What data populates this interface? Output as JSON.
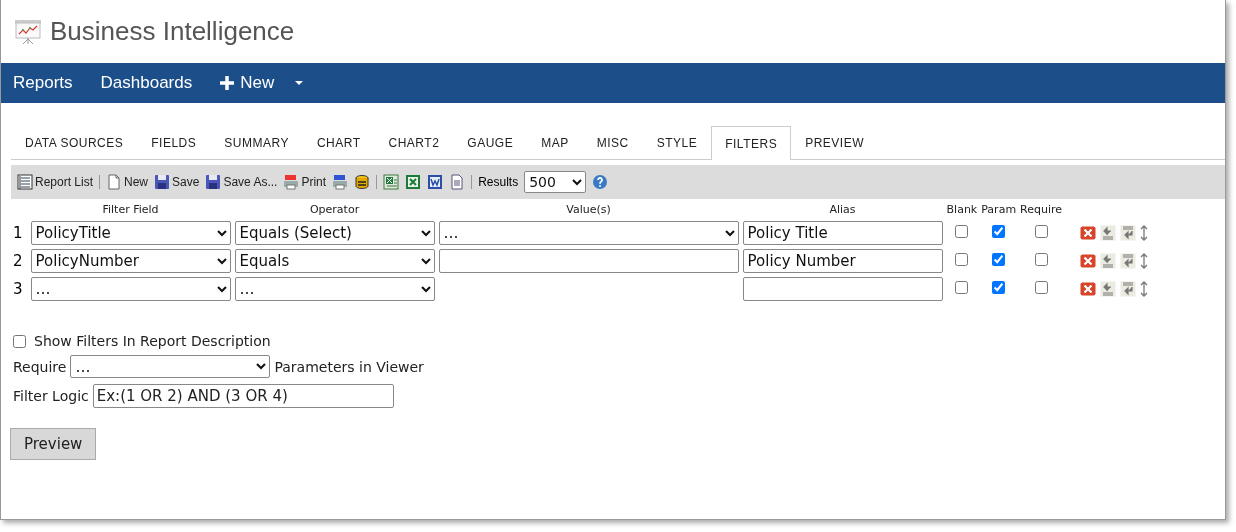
{
  "header": {
    "title": "Business Intelligence"
  },
  "nav": [
    {
      "label": "Reports",
      "kind": "link"
    },
    {
      "label": "Dashboards",
      "kind": "link"
    },
    {
      "label": "New",
      "kind": "new"
    }
  ],
  "tabs": [
    {
      "label": "DATA SOURCES",
      "selected": false
    },
    {
      "label": "FIELDS",
      "selected": false
    },
    {
      "label": "SUMMARY",
      "selected": false
    },
    {
      "label": "CHART",
      "selected": false
    },
    {
      "label": "CHART2",
      "selected": false
    },
    {
      "label": "GAUGE",
      "selected": false
    },
    {
      "label": "MAP",
      "selected": false
    },
    {
      "label": "MISC",
      "selected": false
    },
    {
      "label": "STYLE",
      "selected": false
    },
    {
      "label": "FILTERS",
      "selected": true
    },
    {
      "label": "PREVIEW",
      "selected": false
    }
  ],
  "toolbar": [
    {
      "kind": "button",
      "label": "Report List"
    },
    {
      "kind": "separator"
    },
    {
      "kind": "button",
      "label": "New"
    },
    {
      "kind": "button",
      "label": "Save"
    },
    {
      "kind": "button",
      "label": "Save As..."
    },
    {
      "kind": "button",
      "label": "Print"
    },
    {
      "kind": "icon"
    },
    {
      "kind": "icon"
    },
    {
      "kind": "separator"
    },
    {
      "kind": "icon"
    },
    {
      "kind": "icon"
    },
    {
      "kind": "icon"
    },
    {
      "kind": "icon"
    },
    {
      "kind": "separator"
    },
    {
      "kind": "results",
      "label": "Results",
      "value": "500"
    },
    {
      "kind": "icon"
    }
  ],
  "filters": {
    "columns": [
      "Filter Field",
      "Operator",
      "Value(s)",
      "Alias",
      "Blank",
      "Param",
      "Require"
    ],
    "rows": [
      {
        "number": "1",
        "field": "PolicyTitle",
        "operator": "Equals (Select)",
        "value": {
          "kind": "select",
          "text": "…"
        },
        "alias": "Policy Title",
        "blank": false,
        "param": true,
        "require": false
      },
      {
        "number": "2",
        "field": "PolicyNumber",
        "operator": "Equals",
        "value": {
          "kind": "input"
        },
        "alias": "Policy Number",
        "blank": false,
        "param": true,
        "require": false
      },
      {
        "number": "3",
        "field": "…",
        "operator": "…",
        "blank": false,
        "param": true,
        "require": false
      }
    ]
  },
  "options": {
    "show_filters": {
      "label": "Show Filters In Report Description",
      "checked": false
    },
    "require": {
      "label": "Require",
      "value": "…",
      "suffix": "Parameters in Viewer"
    },
    "filter_logic": {
      "label": "Filter Logic",
      "placeholder": "Ex:(1 OR 2) AND (3 OR 4)"
    }
  },
  "preview_button": "Preview"
}
